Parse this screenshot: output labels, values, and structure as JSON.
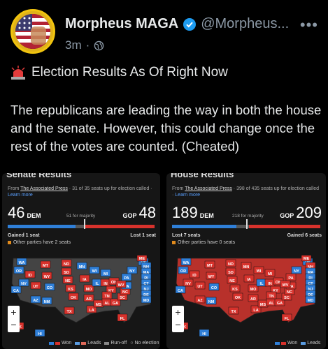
{
  "post": {
    "display_name": "Morpheus MAGA",
    "handle": "@Morpheus...",
    "time": "3m",
    "title": "Election Results As Of Right Now",
    "body": "The republicans are leading the way in both the house and the senate. However, this could change once the rest of the votes are counted. (Cheated)",
    "more_label": "•••",
    "icons": [
      "avatar-flag",
      "verified-badge",
      "globe",
      "police-siren"
    ]
  },
  "senate": {
    "title": "Senate Results",
    "source_prefix": "From ",
    "source_link": "The Associated Press",
    "source_rest": " · 31 of 35 seats up for election called · ",
    "learn_more": "Learn more",
    "dem_seats": "46",
    "dem_label": "DEM",
    "gop_label": "GOP",
    "gop_seats": "48",
    "majority": "51 for majority",
    "gained": "Gained 1 seat",
    "lost": "Lost 1 seat",
    "other": "Other parties have 2 seats",
    "dem_share": 0.46,
    "gop_share": 0.48,
    "state_labels": [
      "WA",
      "OR",
      "CA",
      "ID",
      "NV",
      "MT",
      "WY",
      "UT",
      "AZ",
      "CO",
      "NM",
      "ND",
      "SD",
      "NE",
      "KS",
      "OK",
      "TX",
      "MN",
      "IA",
      "MO",
      "AR",
      "LA",
      "WI",
      "IL",
      "MS",
      "AL",
      "GA",
      "FL",
      "MI",
      "IN",
      "OH",
      "KY",
      "TN",
      "SC",
      "NC",
      "VA",
      "WV",
      "PA",
      "NY",
      "VT",
      "NH",
      "MA",
      "RI",
      "CT",
      "NJ",
      "DE",
      "MD",
      "ME",
      "AK",
      "HI"
    ]
  },
  "house": {
    "title": "House Results",
    "source_prefix": "From ",
    "source_link": "The Associated Press",
    "source_rest": " · 398 of 435 seats up for election called · ",
    "learn_more": "Learn more",
    "dem_seats": "189",
    "dem_label": "DEM",
    "gop_label": "GOP",
    "gop_seats": "209",
    "majority": "218 for majority",
    "gained": "Gained 6 seats",
    "lost": "Lost 7 seats",
    "other": "Other parties have 0 seats",
    "dem_share": 0.434,
    "gop_share": 0.48,
    "state_labels": [
      "WA",
      "OR",
      "CA",
      "ID",
      "NV",
      "MT",
      "WY",
      "UT",
      "AZ",
      "CO",
      "NM",
      "ND",
      "SD",
      "NE",
      "KS",
      "OK",
      "TX",
      "MN",
      "IA",
      "MO",
      "AR",
      "LA",
      "WI",
      "IL",
      "MS",
      "AL",
      "GA",
      "FL",
      "MI",
      "IN",
      "OH",
      "KY",
      "TN",
      "SC",
      "NC",
      "VA",
      "WV",
      "PA",
      "NY",
      "VT",
      "NH",
      "MA",
      "RI",
      "CT",
      "NJ",
      "DE",
      "MD",
      "ME",
      "AK",
      "HI"
    ]
  },
  "legend": {
    "won": "Won",
    "leads": "Leads",
    "runoff": "Run-off",
    "no_election": "No election"
  },
  "colors": {
    "dem": "#2f7fd8",
    "gop": "#d8322c",
    "dem_light": "#5a9be0",
    "gop_light": "#e06a5a",
    "panel": "#161616"
  }
}
